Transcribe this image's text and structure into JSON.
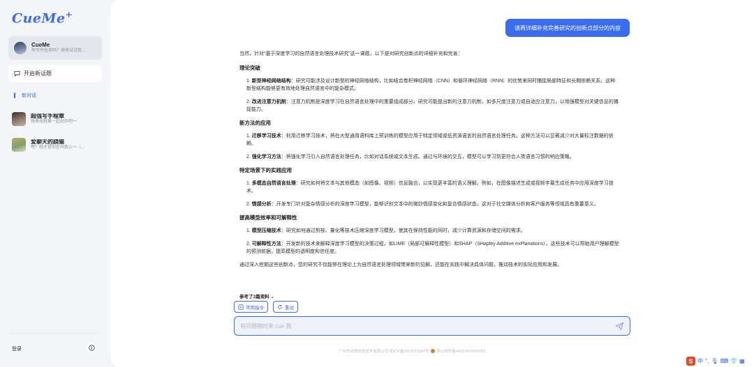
{
  "app": {
    "logo": "CueMe",
    "logo_plus": "+"
  },
  "sidebar": {
    "agent": {
      "name": "CueMe",
      "subtitle": "有写作任务吗？快来试试我..."
    },
    "new_chat_label": "开启新话题",
    "section_label": "新对话",
    "conversations": [
      {
        "title": "超强写手程章",
        "subtitle": "快来找程章一起创作吧～"
      },
      {
        "title": "爱聊天的跷猫",
        "subtitle": "嘿？刚才是你在叫我么～（..."
      }
    ],
    "login_label": "登录"
  },
  "chat": {
    "user_message": "请再详细补充完善研究的创新点部分的内容",
    "answer": {
      "intro": "当然，针对“基于深度学习的自然语言处理技术研究”这一课题，以下是对研究创新点的详细补充和完善：",
      "sections": [
        {
          "heading": "理论突破",
          "items": [
            {
              "label": "新型神经网络结构",
              "text": "：研究可能涉及设计新型的神经网络结构，比如结合卷积神经网络（CNN）和循环神经网络（RNN）的优势来同时捕捉局部特征和长期依赖关系。这种新型结构能够更有效地处理自然语言中的复杂模式。"
            },
            {
              "label": "改进注意力机制",
              "text": "：注意力机制是深度学习在自然语言处理中的重要组成部分。研究可能提出新的注意力机制，如多尺度注意力或自适应注意力，以增强模型对关键信息的捕捉能力。"
            }
          ]
        },
        {
          "heading": "新方法的应用",
          "items": [
            {
              "label": "迁移学习技术",
              "text": "：利用迁移学习技术，将在大型通用语料库上预训练的模型应用于特定领域或低资源语言的自然语言处理任务。这种方法可以显著减少对大量标注数据的依赖。"
            },
            {
              "label": "强化学习方法",
              "text": "：将强化学习引入自然语言处理任务，比如对话系统或文本生成。通过与环境的交互，模型可以学习到更符合人类语言习惯的响应策略。"
            }
          ]
        },
        {
          "heading": "特定场景下的实践应用",
          "items": [
            {
              "label": "多模态自然语言处理",
              "text": "：研究如何将文本与其他模态（如图像、视频）信息融合，以实现更丰富的语义理解。例如，在图像描述生成或视频字幕生成任务中应用深度学习技术。"
            },
            {
              "label": "情感分析",
              "text": "：开发专门针对复杂情感分析的深度学习模型，能够识别文本中的微妙情感变化和复合情感状态，这对于社交媒体分析和客户服务等领域具有重要意义。"
            }
          ]
        },
        {
          "heading": "提高模型效率和可解释性",
          "items": [
            {
              "label": "模型压缩技术",
              "text": "：研究如何通过剪枝、量化等技术压缩深度学习模型，使其在保持性能的同时，减少计算资源和存储空间的需求。"
            },
            {
              "label": "可解释性方法",
              "text": "：开发新的技术来解释深度学习模型的决策过程，如LIME（局部可解释性模型）和SHAP（SHapley Additive exPlanations）。这些技术可以帮助用户理解模型的预测依据，提高模型的透明度和信任度。"
            }
          ]
        }
      ],
      "conclusion": "通过深入挖掘这些创新点，您的研究不仅能够在理论上为自然语言处理领域带来新的见解，还能在实践中解决具体问题，推动技术的实际应用和发展。",
      "references_label": "参考了3篇资料"
    },
    "toolbar": {
      "common_commands": "常用指令",
      "retry": "重试"
    },
    "input": {
      "placeholder": "有问题随时来 cue 我",
      "value": ""
    }
  },
  "footer": {
    "company": "广州市动悦信息技术有限公司 粤ICP备2022013084号",
    "police": "粤公网安备44010502003055"
  },
  "ime": {
    "lang": "中",
    "punct": "°,"
  },
  "colors": {
    "accent": "#3a6cf0",
    "ime_brand": "#e8452b"
  }
}
